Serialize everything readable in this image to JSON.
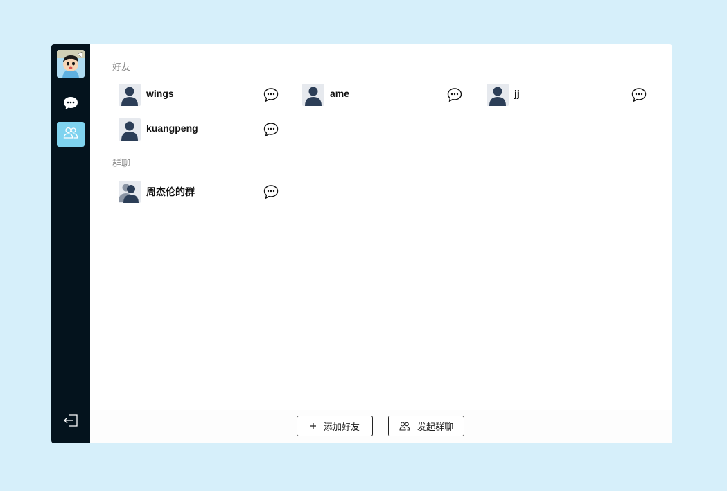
{
  "sidebar": {
    "avatar_icon": "user-avatar-cartoon",
    "nav": [
      {
        "name": "chat",
        "icon": "chat-bubble-icon",
        "active": false
      },
      {
        "name": "contacts",
        "icon": "contacts-icon",
        "active": true
      }
    ],
    "logout_icon": "logout-icon",
    "accent": "#7fd3ef",
    "background": "#04131d"
  },
  "friends": {
    "title": "好友",
    "items": [
      {
        "name": "wings"
      },
      {
        "name": "ame"
      },
      {
        "name": "jj"
      },
      {
        "name": "kuangpeng"
      }
    ]
  },
  "groups": {
    "title": "群聊",
    "items": [
      {
        "name": "周杰伦的群"
      }
    ]
  },
  "footer": {
    "add_friend_label": "添加好友",
    "start_group_label": "发起群聊"
  }
}
